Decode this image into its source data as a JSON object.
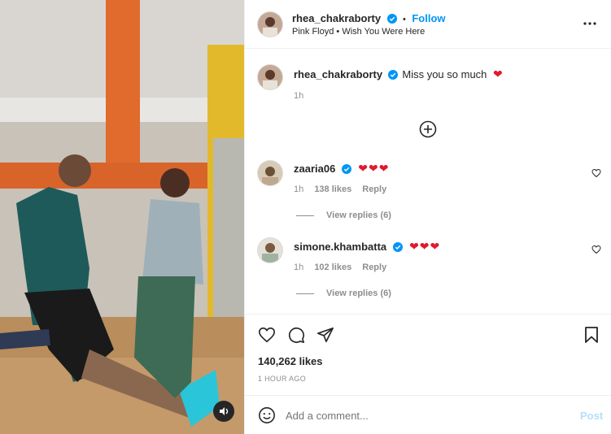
{
  "post": {
    "username": "rhea_chakraborty",
    "follow_label": "Follow",
    "dot": "•",
    "audio": "Pink Floyd • Wish You Were Here",
    "more_label": "•••"
  },
  "caption": {
    "username": "rhea_chakraborty",
    "text": "Miss you so much",
    "heart": "❤",
    "time": "1h"
  },
  "comments": [
    {
      "username": "zaaria06",
      "text": "❤❤❤",
      "time": "1h",
      "likes": "138 likes",
      "reply": "Reply",
      "view_replies": "View replies (6)"
    },
    {
      "username": "simone.khambatta",
      "text": "❤❤❤",
      "time": "1h",
      "likes": "102 likes",
      "reply": "Reply",
      "view_replies": "View replies (6)"
    }
  ],
  "stats": {
    "likes": "140,262 likes",
    "posted": "1 HOUR AGO"
  },
  "composer": {
    "placeholder": "Add a comment...",
    "post_label": "Post"
  },
  "colors": {
    "accent": "#0095f6",
    "heart": "#e0192e",
    "muted": "#8e8e8e"
  }
}
